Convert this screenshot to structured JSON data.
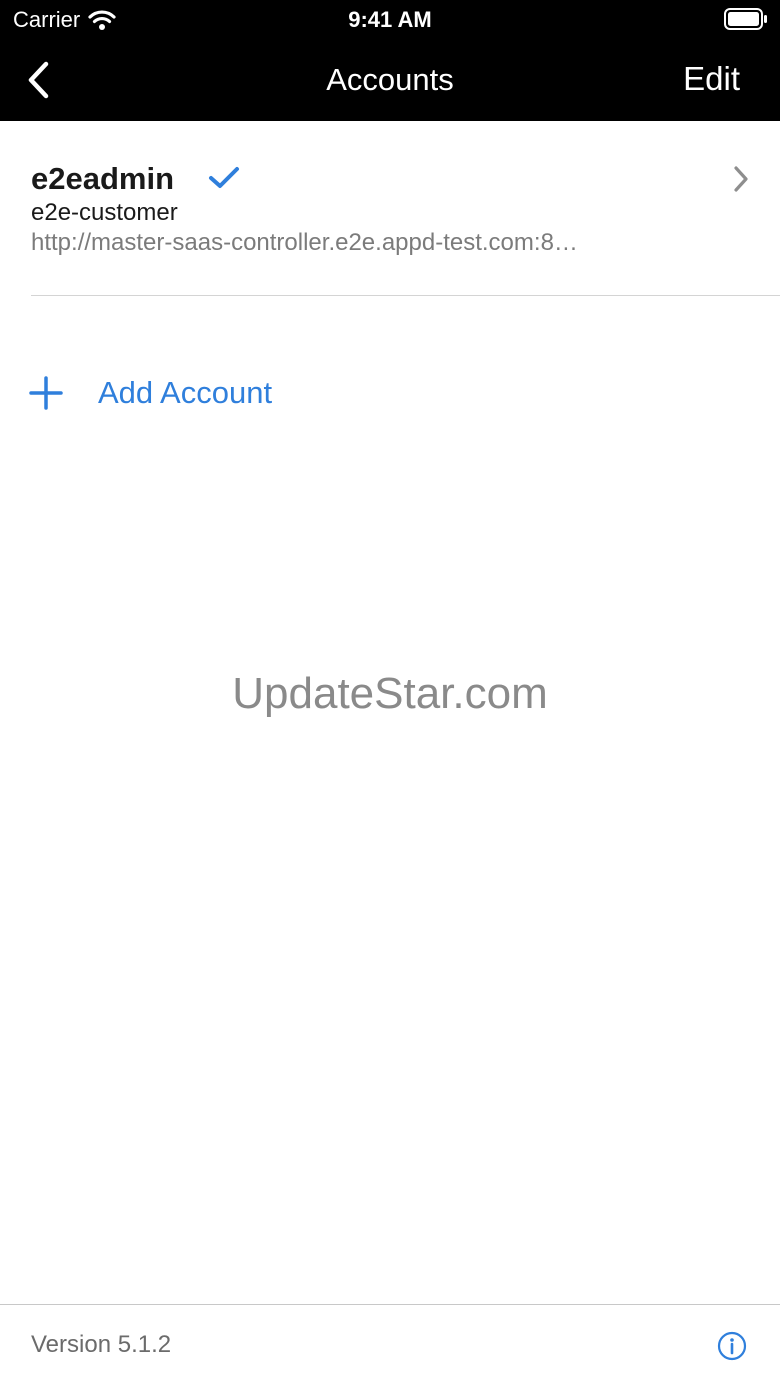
{
  "status_bar": {
    "carrier": "Carrier",
    "time": "9:41 AM",
    "wifi_icon": "wifi-icon",
    "battery_icon": "battery-full-icon"
  },
  "nav": {
    "back_icon": "chevron-left-icon",
    "title": "Accounts",
    "edit_label": "Edit"
  },
  "accounts": [
    {
      "name": "e2eadmin",
      "selected": true,
      "customer": "e2e-customer",
      "url": "http://master-saas-controller.e2e.appd-test.com:8…"
    }
  ],
  "add_account": {
    "label": "Add Account",
    "icon": "plus-icon"
  },
  "watermark": "UpdateStar.com",
  "footer": {
    "version": "Version 5.1.2",
    "info_icon": "info-icon"
  },
  "colors": {
    "accent": "#2f7fdc",
    "nav_background": "#000000",
    "secondary_text": "#7b7b7b"
  }
}
